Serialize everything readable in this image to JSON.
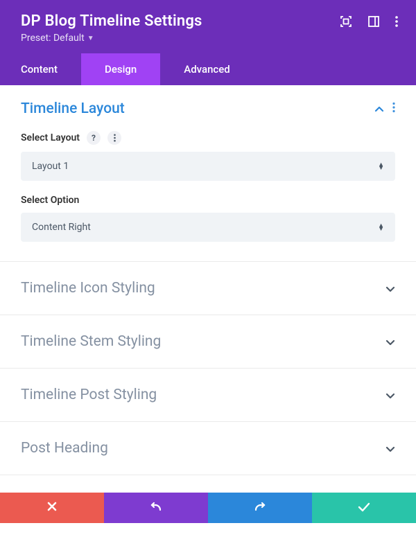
{
  "header": {
    "title": "DP Blog Timeline Settings",
    "preset_label": "Preset: Default"
  },
  "tabs": {
    "content": "Content",
    "design": "Design",
    "advanced": "Advanced"
  },
  "sections": {
    "timeline_layout": {
      "title": "Timeline Layout",
      "fields": {
        "select_layout": {
          "label": "Select Layout",
          "value": "Layout 1"
        },
        "select_option": {
          "label": "Select Option",
          "value": "Content Right"
        }
      }
    },
    "timeline_icon_styling": "Timeline Icon Styling",
    "timeline_stem_styling": "Timeline Stem Styling",
    "timeline_post_styling": "Timeline Post Styling",
    "post_heading": "Post Heading"
  }
}
